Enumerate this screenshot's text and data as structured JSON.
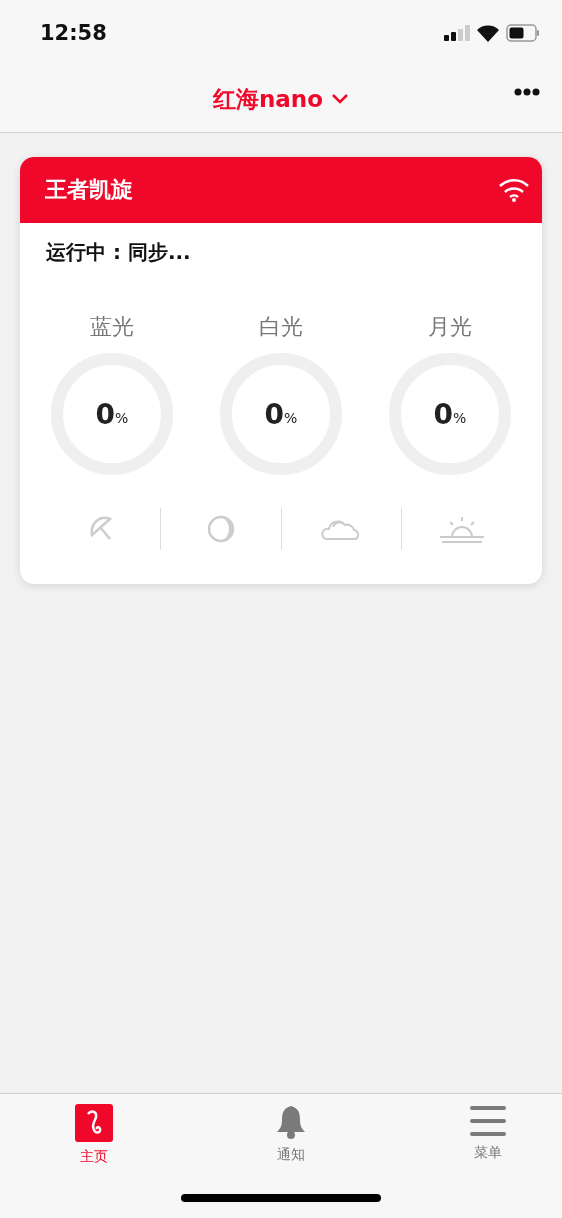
{
  "status_bar": {
    "time": "12:58"
  },
  "nav": {
    "title": "红海nano"
  },
  "device": {
    "name": "王者凯旋",
    "online": true,
    "status": "运行中 : 同步..."
  },
  "channels": [
    {
      "name": "蓝光",
      "value": "0",
      "unit": "%",
      "level": 0
    },
    {
      "name": "白光",
      "value": "0",
      "unit": "%",
      "level": 0
    },
    {
      "name": "月光",
      "value": "0",
      "unit": "%",
      "level": 0
    }
  ],
  "modes": [
    {
      "kind": "umbrella"
    },
    {
      "kind": "moon"
    },
    {
      "kind": "cloud"
    },
    {
      "kind": "sunrise"
    }
  ],
  "tabs": [
    {
      "label": "主页",
      "kind": "home",
      "selected": true
    },
    {
      "label": "通知",
      "kind": "bell",
      "selected": false
    },
    {
      "label": "菜单",
      "kind": "menu",
      "selected": false
    }
  ]
}
